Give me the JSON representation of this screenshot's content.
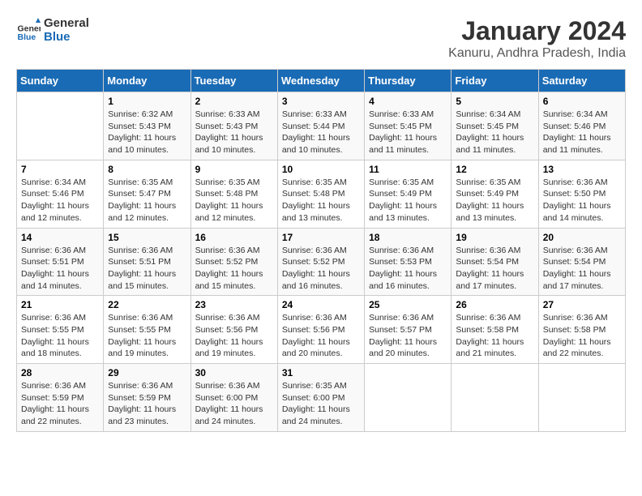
{
  "logo": {
    "line1": "General",
    "line2": "Blue"
  },
  "title": "January 2024",
  "subtitle": "Kanuru, Andhra Pradesh, India",
  "days_of_week": [
    "Sunday",
    "Monday",
    "Tuesday",
    "Wednesday",
    "Thursday",
    "Friday",
    "Saturday"
  ],
  "weeks": [
    [
      {
        "day": "",
        "info": ""
      },
      {
        "day": "1",
        "info": "Sunrise: 6:32 AM\nSunset: 5:43 PM\nDaylight: 11 hours\nand 10 minutes."
      },
      {
        "day": "2",
        "info": "Sunrise: 6:33 AM\nSunset: 5:43 PM\nDaylight: 11 hours\nand 10 minutes."
      },
      {
        "day": "3",
        "info": "Sunrise: 6:33 AM\nSunset: 5:44 PM\nDaylight: 11 hours\nand 10 minutes."
      },
      {
        "day": "4",
        "info": "Sunrise: 6:33 AM\nSunset: 5:45 PM\nDaylight: 11 hours\nand 11 minutes."
      },
      {
        "day": "5",
        "info": "Sunrise: 6:34 AM\nSunset: 5:45 PM\nDaylight: 11 hours\nand 11 minutes."
      },
      {
        "day": "6",
        "info": "Sunrise: 6:34 AM\nSunset: 5:46 PM\nDaylight: 11 hours\nand 11 minutes."
      }
    ],
    [
      {
        "day": "7",
        "info": "Sunrise: 6:34 AM\nSunset: 5:46 PM\nDaylight: 11 hours\nand 12 minutes."
      },
      {
        "day": "8",
        "info": "Sunrise: 6:35 AM\nSunset: 5:47 PM\nDaylight: 11 hours\nand 12 minutes."
      },
      {
        "day": "9",
        "info": "Sunrise: 6:35 AM\nSunset: 5:48 PM\nDaylight: 11 hours\nand 12 minutes."
      },
      {
        "day": "10",
        "info": "Sunrise: 6:35 AM\nSunset: 5:48 PM\nDaylight: 11 hours\nand 13 minutes."
      },
      {
        "day": "11",
        "info": "Sunrise: 6:35 AM\nSunset: 5:49 PM\nDaylight: 11 hours\nand 13 minutes."
      },
      {
        "day": "12",
        "info": "Sunrise: 6:35 AM\nSunset: 5:49 PM\nDaylight: 11 hours\nand 13 minutes."
      },
      {
        "day": "13",
        "info": "Sunrise: 6:36 AM\nSunset: 5:50 PM\nDaylight: 11 hours\nand 14 minutes."
      }
    ],
    [
      {
        "day": "14",
        "info": "Sunrise: 6:36 AM\nSunset: 5:51 PM\nDaylight: 11 hours\nand 14 minutes."
      },
      {
        "day": "15",
        "info": "Sunrise: 6:36 AM\nSunset: 5:51 PM\nDaylight: 11 hours\nand 15 minutes."
      },
      {
        "day": "16",
        "info": "Sunrise: 6:36 AM\nSunset: 5:52 PM\nDaylight: 11 hours\nand 15 minutes."
      },
      {
        "day": "17",
        "info": "Sunrise: 6:36 AM\nSunset: 5:52 PM\nDaylight: 11 hours\nand 16 minutes."
      },
      {
        "day": "18",
        "info": "Sunrise: 6:36 AM\nSunset: 5:53 PM\nDaylight: 11 hours\nand 16 minutes."
      },
      {
        "day": "19",
        "info": "Sunrise: 6:36 AM\nSunset: 5:54 PM\nDaylight: 11 hours\nand 17 minutes."
      },
      {
        "day": "20",
        "info": "Sunrise: 6:36 AM\nSunset: 5:54 PM\nDaylight: 11 hours\nand 17 minutes."
      }
    ],
    [
      {
        "day": "21",
        "info": "Sunrise: 6:36 AM\nSunset: 5:55 PM\nDaylight: 11 hours\nand 18 minutes."
      },
      {
        "day": "22",
        "info": "Sunrise: 6:36 AM\nSunset: 5:55 PM\nDaylight: 11 hours\nand 19 minutes."
      },
      {
        "day": "23",
        "info": "Sunrise: 6:36 AM\nSunset: 5:56 PM\nDaylight: 11 hours\nand 19 minutes."
      },
      {
        "day": "24",
        "info": "Sunrise: 6:36 AM\nSunset: 5:56 PM\nDaylight: 11 hours\nand 20 minutes."
      },
      {
        "day": "25",
        "info": "Sunrise: 6:36 AM\nSunset: 5:57 PM\nDaylight: 11 hours\nand 20 minutes."
      },
      {
        "day": "26",
        "info": "Sunrise: 6:36 AM\nSunset: 5:58 PM\nDaylight: 11 hours\nand 21 minutes."
      },
      {
        "day": "27",
        "info": "Sunrise: 6:36 AM\nSunset: 5:58 PM\nDaylight: 11 hours\nand 22 minutes."
      }
    ],
    [
      {
        "day": "28",
        "info": "Sunrise: 6:36 AM\nSunset: 5:59 PM\nDaylight: 11 hours\nand 22 minutes."
      },
      {
        "day": "29",
        "info": "Sunrise: 6:36 AM\nSunset: 5:59 PM\nDaylight: 11 hours\nand 23 minutes."
      },
      {
        "day": "30",
        "info": "Sunrise: 6:36 AM\nSunset: 6:00 PM\nDaylight: 11 hours\nand 24 minutes."
      },
      {
        "day": "31",
        "info": "Sunrise: 6:35 AM\nSunset: 6:00 PM\nDaylight: 11 hours\nand 24 minutes."
      },
      {
        "day": "",
        "info": ""
      },
      {
        "day": "",
        "info": ""
      },
      {
        "day": "",
        "info": ""
      }
    ]
  ]
}
